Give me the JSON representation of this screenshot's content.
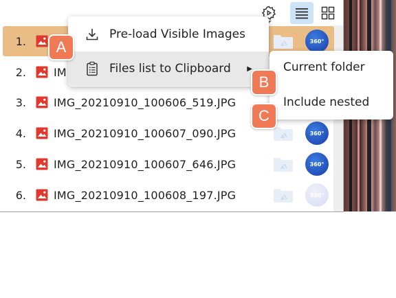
{
  "toolbar": {
    "settings_icon": "gear-play-icon",
    "list_view_icon": "list-view-icon",
    "grid_view_icon": "grid-view-icon"
  },
  "files": [
    {
      "index": "1.",
      "name": "",
      "selected": true,
      "badge": "360°",
      "badge_faded": false
    },
    {
      "index": "2.",
      "name": "IM",
      "selected": false,
      "badge": "360°",
      "badge_faded": false
    },
    {
      "index": "3.",
      "name": "IMG_20210910_100606_519.JPG",
      "selected": false,
      "badge": "",
      "badge_faded": false
    },
    {
      "index": "4.",
      "name": "IMG_20210910_100607_090.JPG",
      "selected": false,
      "badge": "360°",
      "badge_faded": false
    },
    {
      "index": "5.",
      "name": "IMG_20210910_100607_646.JPG",
      "selected": false,
      "badge": "360°",
      "badge_faded": false
    },
    {
      "index": "6.",
      "name": "IMG_20210910_100608_197.JPG",
      "selected": false,
      "badge": "360°",
      "badge_faded": true
    }
  ],
  "context_menu": {
    "items": [
      {
        "label": "Pre-load Visible Images",
        "icon": "download-icon"
      },
      {
        "label": "Files list to Clipboard",
        "icon": "clipboard-list-icon",
        "has_submenu": true
      }
    ]
  },
  "submenu": {
    "items": [
      {
        "label": "Current folder"
      },
      {
        "label": "Include nested"
      }
    ]
  },
  "callouts": {
    "a": "A",
    "b": "B",
    "c": "C"
  },
  "colors": {
    "selected_row": "#eabd86",
    "callout": "#f07a55",
    "badge": "#1a3fa8",
    "file_icon": "#e03a2f",
    "active_toolbar": "#cde3f7"
  }
}
